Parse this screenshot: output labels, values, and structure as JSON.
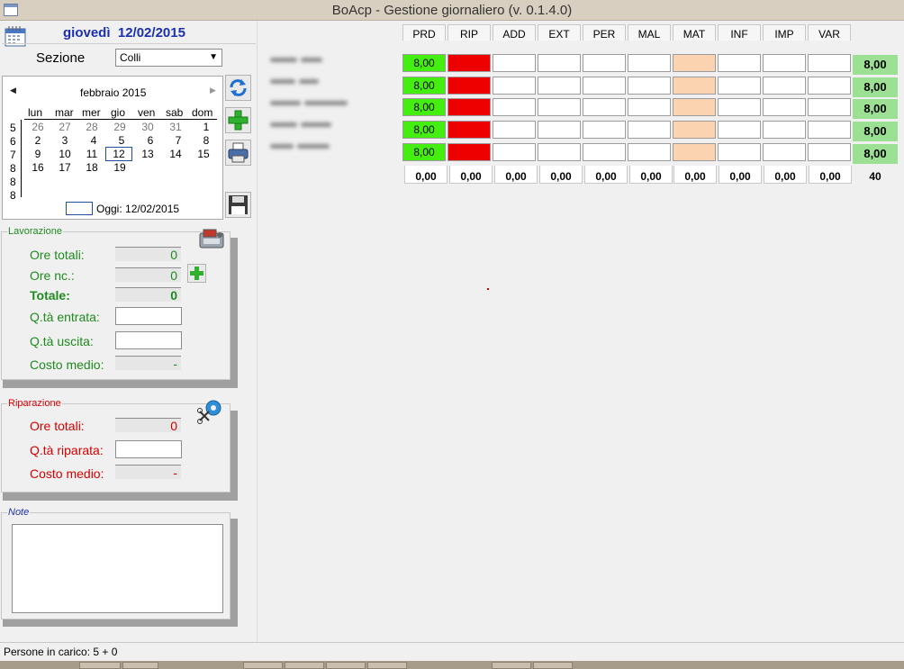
{
  "window": {
    "title": "BoAcp - Gestione giornaliero (v. 0.1.4.0)"
  },
  "header": {
    "weekday": "giovedì",
    "date": "12/02/2015"
  },
  "sezione": {
    "label": "Sezione",
    "selected": "Colli"
  },
  "calendar": {
    "month_label": "febbraio 2015",
    "weekday_headers": [
      "lun",
      "mar",
      "mer",
      "gio",
      "ven",
      "sab",
      "dom"
    ],
    "week_numbers": [
      "5",
      "6",
      "7",
      "8",
      "8",
      "8"
    ],
    "weeks": [
      [
        "26",
        "27",
        "28",
        "29",
        "30",
        "31",
        "1"
      ],
      [
        "2",
        "3",
        "4",
        "5",
        "6",
        "7",
        "8"
      ],
      [
        "9",
        "10",
        "11",
        "12",
        "13",
        "14",
        "15"
      ],
      [
        "16",
        "17",
        "18",
        "19",
        "",
        "",
        ""
      ]
    ],
    "today_label": "Oggi: 12/02/2015"
  },
  "lavorazione": {
    "title": "Lavorazione",
    "ore_totali_label": "Ore totali:",
    "ore_totali_value": "0",
    "ore_nc_label": "Ore nc.:",
    "ore_nc_value": "0",
    "totale_label": "Totale:",
    "totale_value": "0",
    "qta_entrata_label": "Q.tà entrata:",
    "qta_uscita_label": "Q.tà uscita:",
    "costo_medio_label": "Costo medio:",
    "costo_medio_value": "-"
  },
  "riparazione": {
    "title": "Riparazione",
    "ore_totali_label": "Ore totali:",
    "ore_totali_value": "0",
    "qta_riparata_label": "Q.tà riparata:",
    "costo_medio_label": "Costo medio:",
    "costo_medio_value": "-"
  },
  "note": {
    "title": "Note",
    "value": ""
  },
  "grid": {
    "columns": [
      "PRD",
      "RIP",
      "ADD",
      "EXT",
      "PER",
      "MAL",
      "MAT",
      "INF",
      "IMP",
      "VAR"
    ],
    "rows": [
      {
        "prd": "8,00",
        "total": "8,00"
      },
      {
        "prd": "8,00",
        "total": "8,00"
      },
      {
        "prd": "8,00",
        "total": "8,00"
      },
      {
        "prd": "8,00",
        "total": "8,00"
      },
      {
        "prd": "8,00",
        "total": "8,00"
      }
    ],
    "footer": [
      "0,00",
      "0,00",
      "0,00",
      "0,00",
      "0,00",
      "0,00",
      "0,00",
      "0,00",
      "0,00",
      "0,00"
    ],
    "footer_total": "40"
  },
  "statusbar": {
    "text": "Persone in carico: 5 + 0"
  },
  "colors": {
    "prd": "#44ee11",
    "rip": "#ee0000",
    "mat": "#fbd3b0",
    "total": "#9be093",
    "date": "#1c2fb0"
  },
  "icons": {
    "refresh": "refresh-icon",
    "add": "plus-icon",
    "print": "printer-icon",
    "save": "floppy-icon"
  }
}
